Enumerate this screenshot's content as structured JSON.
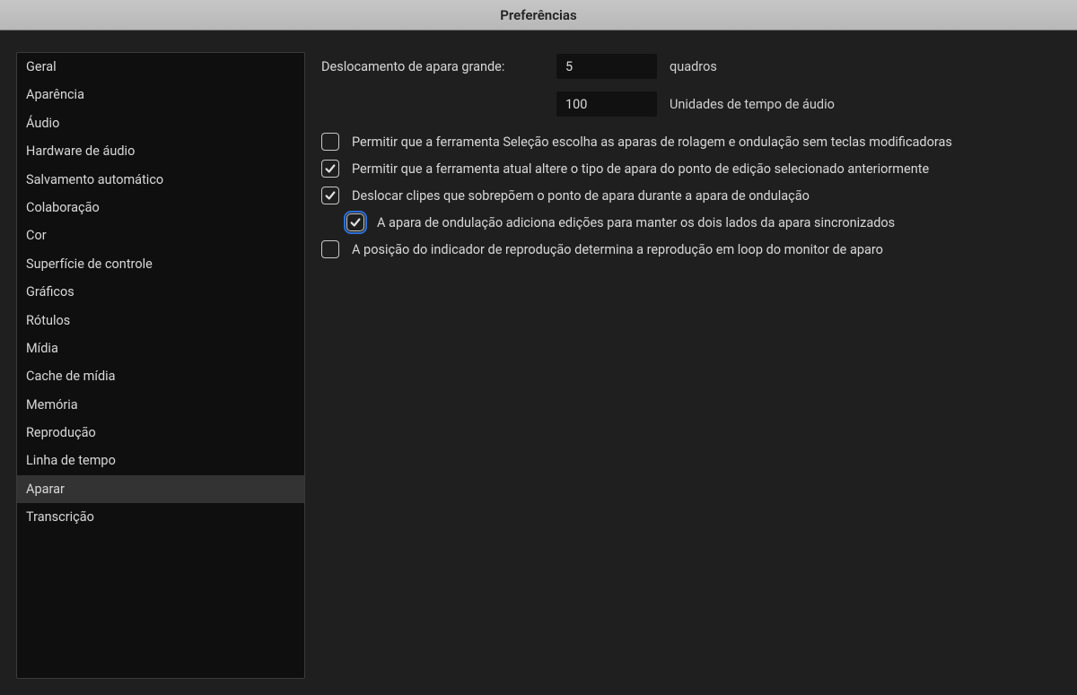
{
  "window": {
    "title": "Preferências"
  },
  "sidebar": {
    "selected": "Aparar",
    "items": [
      "Geral",
      "Aparência",
      "Áudio",
      "Hardware de áudio",
      "Salvamento automático",
      "Colaboração",
      "Cor",
      "Superfície de controle",
      "Gráficos",
      "Rótulos",
      "Mídia",
      "Cache de mídia",
      "Memória",
      "Reprodução",
      "Linha de tempo",
      "Aparar",
      "Transcrição"
    ]
  },
  "settings": {
    "big_trim_label": "Deslocamento de apara grande:",
    "big_trim_value": "5",
    "big_trim_unit": "quadros",
    "audio_time_value": "100",
    "audio_time_unit": "Unidades de tempo de áudio",
    "checks": [
      {
        "checked": false,
        "label": "Permitir que a ferramenta Seleção escolha as aparas de rolagem e ondulação sem teclas modificadoras",
        "indent": false,
        "focused": false
      },
      {
        "checked": true,
        "label": "Permitir que a ferramenta atual altere o tipo de apara do ponto de edição selecionado anteriormente",
        "indent": false,
        "focused": false
      },
      {
        "checked": true,
        "label": "Deslocar clipes que sobrepõem o ponto de apara durante a apara de ondulação",
        "indent": false,
        "focused": false
      },
      {
        "checked": true,
        "label": "A apara de ondulação adiciona edições para manter os dois lados da apara sincronizados",
        "indent": true,
        "focused": true
      },
      {
        "checked": false,
        "label": "A posição do indicador de reprodução determina a reprodução em loop do monitor de aparo",
        "indent": false,
        "focused": false
      }
    ]
  }
}
